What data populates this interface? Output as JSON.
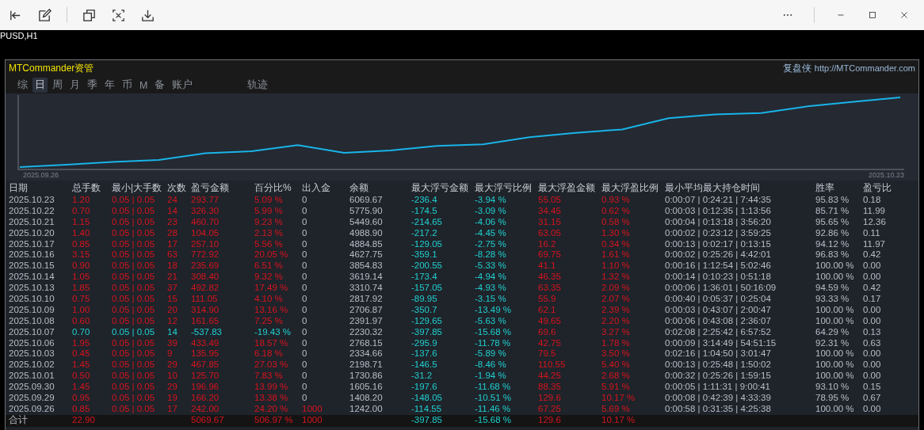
{
  "chart_window": {
    "symbol": "PUSD,H1"
  },
  "panel": {
    "title": "MTCommander资管",
    "brand": "复盘侠",
    "link": "http://MTCommander.com"
  },
  "tabs": [
    {
      "label": "综",
      "selected": false
    },
    {
      "label": "日",
      "selected": true
    },
    {
      "label": "周",
      "selected": false
    },
    {
      "label": "月",
      "selected": false
    },
    {
      "label": "季",
      "selected": false
    },
    {
      "label": "年",
      "selected": false
    },
    {
      "label": "币",
      "selected": false
    },
    {
      "label": "M",
      "selected": false
    },
    {
      "label": "备",
      "selected": false
    },
    {
      "label": "账户",
      "selected": false
    },
    {
      "label": "轨迹",
      "selected": false
    }
  ],
  "equity_chart": {
    "start_date": "2025.09.26",
    "end_date": "2025.10.23"
  },
  "table": {
    "columns": [
      "日期",
      "总手数",
      "最小|大手数",
      "次数",
      "盈亏金额",
      "百分比%",
      "出入金",
      "余额",
      "最大浮亏金额",
      "最大浮亏比例",
      "最大浮盈金额",
      "最大浮盈比例",
      "最小平均最大持仓时间",
      "胜率",
      "盈亏比"
    ],
    "rows": [
      {
        "kind": "gain",
        "deposit_highlight": false,
        "cells": [
          "2025.10.23",
          "1.20",
          "0.05 | 0.05",
          "24",
          "293.77",
          "5.09 %",
          "0",
          "6069.67",
          "-236.4",
          "-3.94 %",
          "55.05",
          "0.93 %",
          "0:00:07 | 0:24:21 | 7:44:35",
          "95.83 %",
          "0.18"
        ]
      },
      {
        "kind": "gain",
        "deposit_highlight": false,
        "cells": [
          "2025.10.22",
          "0.70",
          "0.05 | 0.05",
          "14",
          "326.30",
          "5.99 %",
          "0",
          "5775.90",
          "-174.5",
          "-3.09 %",
          "34.45",
          "0.62 %",
          "0:00:03 | 0:12:35 | 1:13:56",
          "85.71 %",
          "11.99"
        ]
      },
      {
        "kind": "gain",
        "deposit_highlight": false,
        "cells": [
          "2025.10.21",
          "1.15",
          "0.05 | 0.05",
          "23",
          "460.70",
          "9.23 %",
          "0",
          "5449.60",
          "-214.65",
          "-4.06 %",
          "31.15",
          "0.58 %",
          "0:00:04 | 0:13:18 | 3:56:20",
          "95.65 %",
          "12.36"
        ]
      },
      {
        "kind": "gain",
        "deposit_highlight": false,
        "cells": [
          "2025.10.20",
          "1.40",
          "0.05 | 0.05",
          "28",
          "104.05",
          "2.13 %",
          "0",
          "4988.90",
          "-217.2",
          "-4.45 %",
          "63.05",
          "1.30 %",
          "0:00:02 | 0:23:12 | 3:59:25",
          "92.86 %",
          "0.11"
        ]
      },
      {
        "kind": "gain",
        "deposit_highlight": false,
        "cells": [
          "2025.10.17",
          "0.85",
          "0.05 | 0.05",
          "17",
          "257.10",
          "5.56 %",
          "0",
          "4884.85",
          "-129.05",
          "-2.75 %",
          "16.2",
          "0.34 %",
          "0:00:13 | 0:02:17 | 0:13:15",
          "94.12 %",
          "11.97"
        ]
      },
      {
        "kind": "gain",
        "deposit_highlight": false,
        "cells": [
          "2025.10.16",
          "3.15",
          "0.05 | 0.05",
          "63",
          "772.92",
          "20.05 %",
          "0",
          "4627.75",
          "-359.1",
          "-8.28 %",
          "69.75",
          "1.61 %",
          "0:00:02 | 0:25:26 | 4:42:01",
          "96.83 %",
          "0.42"
        ]
      },
      {
        "kind": "gain",
        "deposit_highlight": false,
        "cells": [
          "2025.10.15",
          "0.90",
          "0.05 | 0.05",
          "18",
          "235.69",
          "6.51 %",
          "0",
          "3854.83",
          "-200.55",
          "-5.33 %",
          "41.1",
          "1.10 %",
          "0:00:16 | 1:12:54 | 5:02:46",
          "100.00 %",
          "0.00"
        ]
      },
      {
        "kind": "gain",
        "deposit_highlight": false,
        "cells": [
          "2025.10.14",
          "1.05",
          "0.05 | 0.05",
          "21",
          "308.40",
          "9.32 %",
          "0",
          "3619.14",
          "-173.4",
          "-4.94 %",
          "46.35",
          "1.32 %",
          "0:00:14 | 0:10:23 | 0:51:18",
          "100.00 %",
          "0.00"
        ]
      },
      {
        "kind": "gain",
        "deposit_highlight": false,
        "cells": [
          "2025.10.13",
          "1.85",
          "0.05 | 0.05",
          "37",
          "492.82",
          "17.49 %",
          "0",
          "3310.74",
          "-157.05",
          "-4.93 %",
          "63.35",
          "2.09 %",
          "0:00:06 | 1:36:01 | 50:16:09",
          "94.59 %",
          "0.42"
        ]
      },
      {
        "kind": "gain",
        "deposit_highlight": false,
        "cells": [
          "2025.10.10",
          "0.75",
          "0.05 | 0.05",
          "15",
          "111.05",
          "4.10 %",
          "0",
          "2817.92",
          "-89.95",
          "-3.15 %",
          "55.9",
          "2.07 %",
          "0:00:40 | 0:05:37 | 0:25:04",
          "93.33 %",
          "0.17"
        ]
      },
      {
        "kind": "gain",
        "deposit_highlight": false,
        "cells": [
          "2025.10.09",
          "1.00",
          "0.05 | 0.05",
          "20",
          "314.90",
          "13.16 %",
          "0",
          "2706.87",
          "-350.7",
          "-13.49 %",
          "62.1",
          "2.39 %",
          "0:00:03 | 0:43:07 | 2:00:47",
          "100.00 %",
          "0.00"
        ]
      },
      {
        "kind": "gain",
        "deposit_highlight": false,
        "cells": [
          "2025.10.08",
          "0.60",
          "0.05 | 0.05",
          "12",
          "161.65",
          "7.25 %",
          "0",
          "2391.97",
          "-129.65",
          "-5.63 %",
          "49.65",
          "2.20 %",
          "0:00:06 | 0:43:08 | 2:36:07",
          "100.00 %",
          "0.00"
        ]
      },
      {
        "kind": "loss",
        "deposit_highlight": false,
        "cells": [
          "2025.10.07",
          "0.70",
          "0.05 | 0.05",
          "14",
          "-537.83",
          "-19.43 %",
          "0",
          "2230.32",
          "-397.85",
          "-15.68 %",
          "69.6",
          "3.27 %",
          "0:02:08 | 2:25:42 | 6:57:52",
          "64.29 %",
          "0.13"
        ]
      },
      {
        "kind": "gain",
        "deposit_highlight": false,
        "cells": [
          "2025.10.06",
          "1.95",
          "0.05 | 0.05",
          "39",
          "433.49",
          "18.57 %",
          "0",
          "2768.15",
          "-295.9",
          "-11.78 %",
          "42.75",
          "1.78 %",
          "0:00:09 | 3:14:49 | 54:51:15",
          "92.31 %",
          "0.63"
        ]
      },
      {
        "kind": "gain",
        "deposit_highlight": false,
        "cells": [
          "2025.10.03",
          "0.45",
          "0.05 | 0.05",
          "9",
          "135.95",
          "6.18 %",
          "0",
          "2334.66",
          "-137.6",
          "-5.89 %",
          "79.5",
          "3.50 %",
          "0:02:16 | 1:04:50 | 3:01:47",
          "100.00 %",
          "0.00"
        ]
      },
      {
        "kind": "gain",
        "deposit_highlight": false,
        "cells": [
          "2025.10.02",
          "1.45",
          "0.05 | 0.05",
          "29",
          "467.85",
          "27.03 %",
          "0",
          "2198.71",
          "-146.5",
          "-8.46 %",
          "110.55",
          "5.40 %",
          "0:00:13 | 0:25:48 | 1:50:02",
          "100.00 %",
          "0.00"
        ]
      },
      {
        "kind": "gain",
        "deposit_highlight": false,
        "cells": [
          "2025.10.01",
          "0.50",
          "0.05 | 0.05",
          "10",
          "125.70",
          "7.83 %",
          "0",
          "1730.86",
          "-31.2",
          "-1.94 %",
          "44.25",
          "2.68 %",
          "0:00:32 | 0:25:26 | 1:59:15",
          "100.00 %",
          "0.00"
        ]
      },
      {
        "kind": "gain",
        "deposit_highlight": false,
        "cells": [
          "2025.09.30",
          "1.45",
          "0.05 | 0.05",
          "29",
          "196.96",
          "13.99 %",
          "0",
          "1605.16",
          "-197.6",
          "-11.68 %",
          "88.35",
          "5.91 %",
          "0:00:05 | 1:11:31 | 9:00:41",
          "93.10 %",
          "0.15"
        ]
      },
      {
        "kind": "gain",
        "deposit_highlight": false,
        "cells": [
          "2025.09.29",
          "0.95",
          "0.05 | 0.05",
          "19",
          "166.20",
          "13.38 %",
          "0",
          "1408.20",
          "-148.05",
          "-10.51 %",
          "129.6",
          "10.17 %",
          "0:00:08 | 0:42:39 | 4:33:39",
          "78.95 %",
          "0.67"
        ]
      },
      {
        "kind": "gain",
        "deposit_highlight": true,
        "cells": [
          "2025.09.26",
          "0.85",
          "0.05 | 0.05",
          "17",
          "242.00",
          "24.20 %",
          "1000",
          "1242.00",
          "-114.55",
          "-11.46 %",
          "67.25",
          "5.69 %",
          "0:00:58 | 0:31:35 | 4:25:38",
          "100.00 %",
          "0.00"
        ]
      }
    ],
    "total": {
      "label": "合计",
      "lots": "22.90",
      "pnl": "5069.67",
      "pct": "506.97 %",
      "deposit": "1000",
      "max_float_loss": "-397.85",
      "max_float_loss_pct": "-15.68 %",
      "max_float_gain": "129.6",
      "max_float_gain_pct": "10.17 %"
    }
  }
}
